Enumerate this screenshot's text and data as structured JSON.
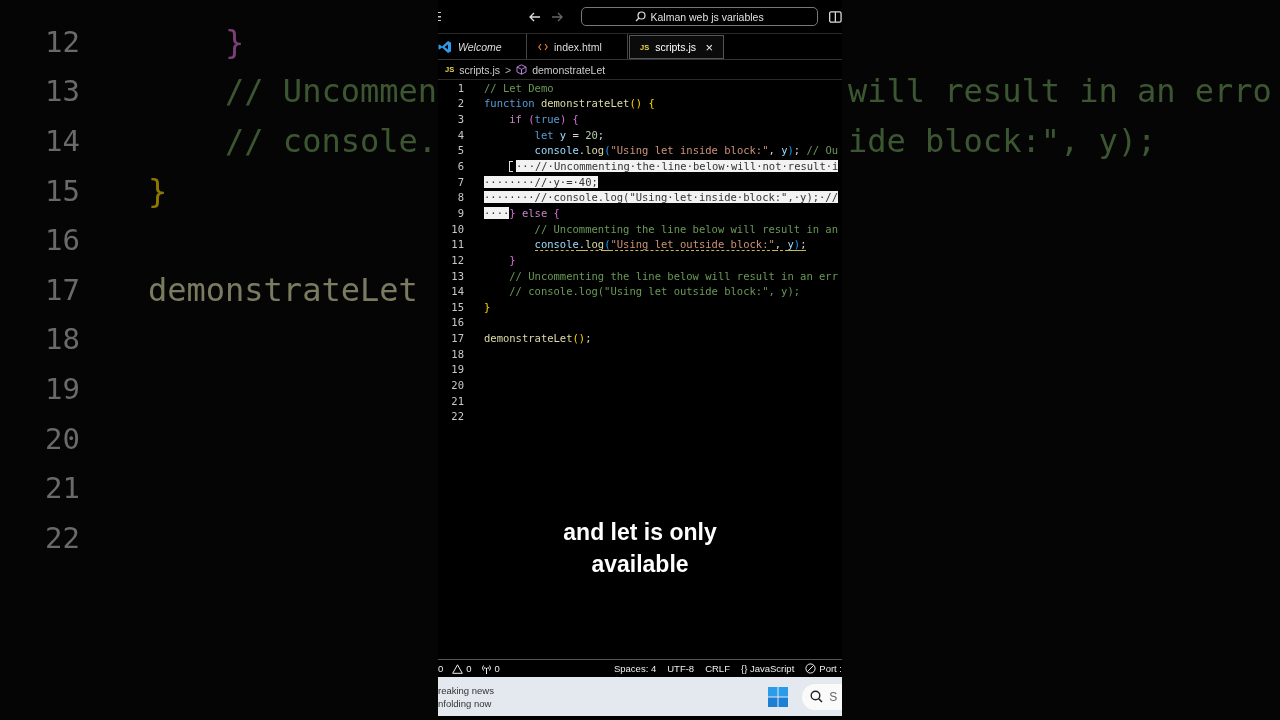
{
  "backdrop": {
    "lines": [
      {
        "number": "12",
        "segments": [
          {
            "text": "    }",
            "kind": "bracket2"
          }
        ]
      },
      {
        "number": "13",
        "segments": [
          {
            "text": "    // Uncommen",
            "kind": "comment"
          }
        ],
        "far_right": [
          {
            "text": "will result in an erro",
            "kind": "comment"
          }
        ]
      },
      {
        "number": "14",
        "segments": [
          {
            "text": "    // console.",
            "kind": "comment"
          }
        ],
        "far_right": [
          {
            "text": "ide block:\", y);",
            "kind": "comment"
          }
        ]
      },
      {
        "number": "15",
        "segments": [
          {
            "text": "}",
            "kind": "bracket1"
          }
        ]
      },
      {
        "number": "16"
      },
      {
        "number": "17",
        "segments": [
          {
            "text": "demonstrateLet",
            "kind": "function"
          }
        ]
      },
      {
        "number": "18"
      },
      {
        "number": "19"
      },
      {
        "number": "20"
      },
      {
        "number": "21"
      },
      {
        "number": "22"
      }
    ]
  },
  "titlebar": {
    "search": "Kalman web js variables"
  },
  "tabs": [
    {
      "label": "Welcome",
      "kind": "welcome",
      "preview": true,
      "selected": false
    },
    {
      "label": "index.html",
      "kind": "html",
      "preview": false,
      "selected": false
    },
    {
      "label": "scripts.js",
      "kind": "js",
      "badge": "JS",
      "preview": false,
      "selected": true,
      "close": "×"
    }
  ],
  "breadcrumb": {
    "badge": "JS",
    "file": "scripts.js",
    "separator": ">",
    "symbol": "demonstrateLet"
  },
  "editor": {
    "lines": [
      {
        "number": "1",
        "segments": [
          {
            "text": "// Let Demo",
            "kind": "comment"
          }
        ]
      },
      {
        "number": "2",
        "segments": [
          {
            "text": "function",
            "kind": "keyword"
          },
          {
            "text": " demonstrateLet",
            "kind": "function"
          },
          {
            "text": "()",
            "kind": "bracket1"
          },
          {
            "text": " {",
            "kind": "bracket1"
          }
        ]
      },
      {
        "number": "3",
        "segments": [
          {
            "text": "    if",
            "kind": "control"
          },
          {
            "text": " (",
            "kind": "bracket2"
          },
          {
            "text": "true",
            "kind": "keyword"
          },
          {
            "text": ")",
            "kind": "bracket2"
          },
          {
            "text": " {",
            "kind": "bracket2"
          }
        ]
      },
      {
        "number": "4",
        "segments": [
          {
            "text": "        let",
            "kind": "keyword"
          },
          {
            "text": " y",
            "kind": "variable"
          },
          {
            "text": " = "
          },
          {
            "text": "20",
            "kind": "number"
          },
          {
            "text": ";"
          }
        ]
      },
      {
        "number": "5",
        "segments": [
          {
            "text": "        console",
            "kind": "variable"
          },
          {
            "text": "."
          },
          {
            "text": "log",
            "kind": "function"
          },
          {
            "text": "(",
            "kind": "bracket3"
          },
          {
            "text": "\"Using let inside block:\"",
            "kind": "string"
          },
          {
            "text": ", "
          },
          {
            "text": "y",
            "kind": "variable"
          },
          {
            "text": ")",
            "kind": "bracket3"
          },
          {
            "text": "; "
          },
          {
            "text": "// Ou",
            "kind": "comment"
          }
        ]
      },
      {
        "number": "6",
        "pointer": true,
        "segments": [
          {
            "text": "···//·Uncommenting·the·line·below·will·not·result·i",
            "selected": true
          }
        ]
      },
      {
        "number": "7",
        "segments": [
          {
            "text": "········//·y·=·40;",
            "selected": true
          }
        ]
      },
      {
        "number": "8",
        "segments": [
          {
            "text": "········//·console.log(\"Using·let·inside·block:\",·y);·//",
            "selected": true
          }
        ]
      },
      {
        "number": "9",
        "segments": [
          {
            "text": "····",
            "selected": true
          },
          {
            "text": "}",
            "kind": "bracket2"
          },
          {
            "text": " else",
            "kind": "control"
          },
          {
            "text": " {",
            "kind": "bracket2"
          }
        ]
      },
      {
        "number": "10",
        "segments": [
          {
            "text": "        // Uncommenting the line below will result in an",
            "kind": "comment"
          }
        ]
      },
      {
        "number": "11",
        "squiggle": true,
        "segments": [
          {
            "text": "        console",
            "kind": "variable"
          },
          {
            "text": "."
          },
          {
            "text": "log",
            "kind": "function"
          },
          {
            "text": "(",
            "kind": "bracket3"
          },
          {
            "text": "\"Using let outside block:\"",
            "kind": "string"
          },
          {
            "text": ", "
          },
          {
            "text": "y",
            "kind": "variable"
          },
          {
            "text": ")",
            "kind": "bracket3"
          },
          {
            "text": ";"
          }
        ]
      },
      {
        "number": "12",
        "segments": [
          {
            "text": "    }",
            "kind": "bracket2"
          }
        ]
      },
      {
        "number": "13",
        "segments": [
          {
            "text": "    // Uncommenting the line below will result in an err",
            "kind": "comment"
          }
        ]
      },
      {
        "number": "14",
        "segments": [
          {
            "text": "    // console.log(\"Using let outside block:\", y);",
            "kind": "comment"
          }
        ]
      },
      {
        "number": "15",
        "segments": [
          {
            "text": "}",
            "kind": "bracket1"
          }
        ]
      },
      {
        "number": "16"
      },
      {
        "number": "17",
        "segments": [
          {
            "text": "demonstrateLet",
            "kind": "function"
          },
          {
            "text": "()",
            "kind": "bracket1"
          },
          {
            "text": ";"
          }
        ]
      },
      {
        "number": "18"
      },
      {
        "number": "19"
      },
      {
        "number": "20"
      },
      {
        "number": "21"
      },
      {
        "number": "22"
      }
    ]
  },
  "caption_lines": [
    "and let is only",
    "available"
  ],
  "status_bar": {
    "left": [
      {
        "text": "0"
      },
      {
        "kind": "warning",
        "text": "0"
      },
      {
        "kind": "antenna",
        "text": "0"
      }
    ],
    "right": [
      {
        "text": "Spaces: 4"
      },
      {
        "text": "UTF-8"
      },
      {
        "text": "CRLF"
      },
      {
        "text": "{} JavaScript"
      },
      {
        "kind": "blocked",
        "text": "Port :"
      }
    ]
  },
  "taskbar": {
    "news_lines": [
      "reaking news",
      "nfolding now"
    ],
    "search": "S"
  }
}
